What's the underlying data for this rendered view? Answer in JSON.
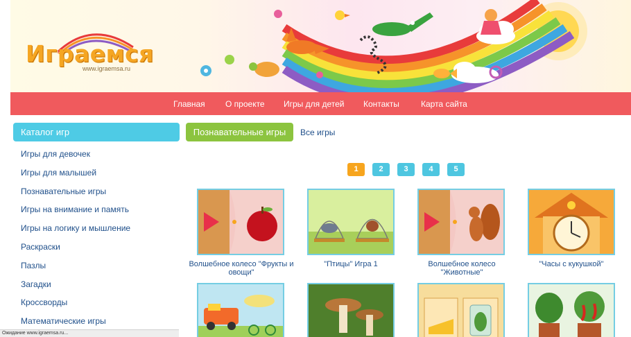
{
  "header": {
    "logo_title": "Играемся",
    "logo_url": "www.igraemsa.ru"
  },
  "nav": {
    "items": [
      {
        "label": "Главная"
      },
      {
        "label": "О проекте"
      },
      {
        "label": "Игры для детей"
      },
      {
        "label": "Контакты"
      },
      {
        "label": "Карта сайта"
      }
    ]
  },
  "sidebar": {
    "title": "Каталог игр",
    "items": [
      {
        "label": "Игры для девочек"
      },
      {
        "label": "Игры для малышей"
      },
      {
        "label": "Познавательные игры"
      },
      {
        "label": "Игры на внимание и память"
      },
      {
        "label": "Игры на логику и мышление"
      },
      {
        "label": "Раскраски"
      },
      {
        "label": "Пазлы"
      },
      {
        "label": "Загадки"
      },
      {
        "label": "Кроссворды"
      },
      {
        "label": "Математические игры"
      }
    ]
  },
  "main": {
    "category_label": "Познавательные игры",
    "all_games_label": "Все игры",
    "pagination": [
      "1",
      "2",
      "3",
      "4",
      "5"
    ],
    "current_page": "1",
    "games": [
      {
        "title": "Волшебное колесо \"Фрукты и овощи\"",
        "icon": "apple-wheel-thumb"
      },
      {
        "title": "\"Птицы\" Игра 1",
        "icon": "birds-cage-thumb"
      },
      {
        "title": "Волшебное колесо \"Животные\"",
        "icon": "squirrel-wheel-thumb"
      },
      {
        "title": "\"Часы с кукушкой\"",
        "icon": "cuckoo-clock-thumb"
      },
      {
        "title": "",
        "icon": "vehicles-thumb"
      },
      {
        "title": "",
        "icon": "mushrooms-thumb"
      },
      {
        "title": "",
        "icon": "cheese-jar-thumb"
      },
      {
        "title": "",
        "icon": "plants-thumb"
      }
    ]
  },
  "status": {
    "text": "Ожидание www.igraemsa.ru..."
  },
  "colors": {
    "nav_bg": "#f05a5d",
    "catalog_bg": "#4ecbe5",
    "category_bg": "#8cc43f",
    "page_active": "#f7a51e",
    "page_default": "#4ec6e0",
    "link": "#1f4f8a"
  }
}
